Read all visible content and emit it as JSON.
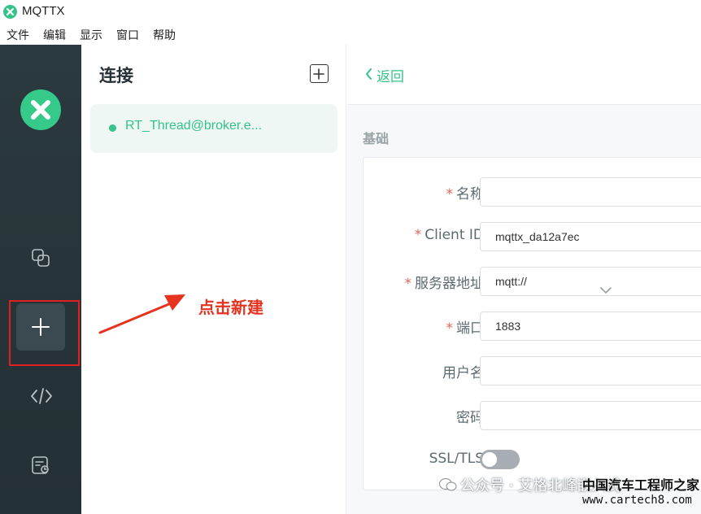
{
  "window": {
    "title": "MQTTX"
  },
  "menu": [
    "文件",
    "编辑",
    "显示",
    "窗口",
    "帮助"
  ],
  "sidebar": {
    "items": [
      {
        "icon": "connections-icon"
      },
      {
        "icon": "plus-icon",
        "active": true
      },
      {
        "icon": "code-icon"
      },
      {
        "icon": "log-icon"
      }
    ]
  },
  "connections": {
    "title": "连接",
    "items": [
      {
        "name": "RT_Thread@broker.e...",
        "status": "connected"
      }
    ]
  },
  "main": {
    "back_label": "返回",
    "section_title": "基础",
    "fields": [
      {
        "label": "名称",
        "required": true,
        "value": ""
      },
      {
        "label": "Client ID",
        "required": true,
        "value": "mqttx_da12a7ec"
      },
      {
        "label": "服务器地址",
        "required": true,
        "value": "mqtt://"
      },
      {
        "label": "端口",
        "required": true,
        "value": "1883"
      },
      {
        "label": "用户名",
        "required": false,
        "value": ""
      },
      {
        "label": "密码",
        "required": false,
        "value": ""
      },
      {
        "label": "SSL/TLS",
        "required": false,
        "value": ""
      }
    ],
    "ssl_enabled": false
  },
  "annotation": {
    "text": "点击新建"
  },
  "watermark": {
    "text": "公众号 · 艾格北峰嵌入式",
    "site_name": "中国汽车工程师之家",
    "site_url": "www.cartech8.com"
  },
  "colors": {
    "accent": "#34c388",
    "sidebar": "#263338",
    "annotation": "#e53320"
  }
}
